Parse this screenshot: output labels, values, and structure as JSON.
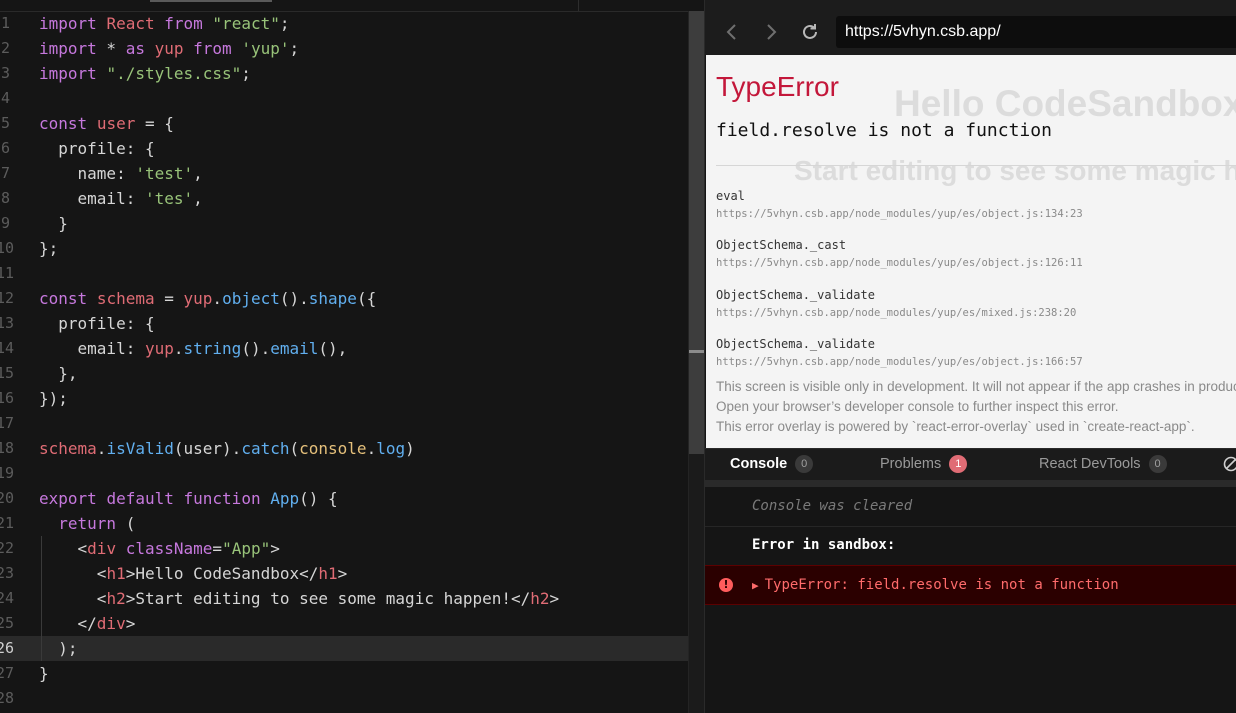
{
  "editor": {
    "lines": [
      {
        "n": "1",
        "tokens": [
          [
            "kw",
            "import"
          ],
          [
            "pn",
            " "
          ],
          [
            "rd",
            "React"
          ],
          [
            "pn",
            " "
          ],
          [
            "kw",
            "from"
          ],
          [
            "pn",
            " "
          ],
          [
            "st",
            "\"react\""
          ],
          [
            "pn",
            ";"
          ]
        ]
      },
      {
        "n": "2",
        "tokens": [
          [
            "kw",
            "import"
          ],
          [
            "pn",
            " * "
          ],
          [
            "kw",
            "as"
          ],
          [
            "pn",
            " "
          ],
          [
            "rd",
            "yup"
          ],
          [
            "pn",
            " "
          ],
          [
            "kw",
            "from"
          ],
          [
            "pn",
            " "
          ],
          [
            "st",
            "'yup'"
          ],
          [
            "pn",
            ";"
          ]
        ]
      },
      {
        "n": "3",
        "tokens": [
          [
            "kw",
            "import"
          ],
          [
            "pn",
            " "
          ],
          [
            "st",
            "\"./styles.css\""
          ],
          [
            "pn",
            ";"
          ]
        ]
      },
      {
        "n": "4",
        "tokens": []
      },
      {
        "n": "5",
        "tokens": [
          [
            "kw",
            "const"
          ],
          [
            "pn",
            " "
          ],
          [
            "rd",
            "user"
          ],
          [
            "pn",
            " = {"
          ]
        ]
      },
      {
        "n": "6",
        "tokens": [
          [
            "pn",
            "  profile: {"
          ]
        ]
      },
      {
        "n": "7",
        "tokens": [
          [
            "pn",
            "    name: "
          ],
          [
            "st",
            "'test'"
          ],
          [
            "pn",
            ","
          ]
        ]
      },
      {
        "n": "8",
        "tokens": [
          [
            "pn",
            "    email: "
          ],
          [
            "st",
            "'tes'"
          ],
          [
            "pn",
            ","
          ]
        ]
      },
      {
        "n": "9",
        "tokens": [
          [
            "pn",
            "  }"
          ]
        ]
      },
      {
        "n": "10",
        "tokens": [
          [
            "pn",
            "};"
          ]
        ]
      },
      {
        "n": "11",
        "tokens": []
      },
      {
        "n": "12",
        "tokens": [
          [
            "kw",
            "const"
          ],
          [
            "pn",
            " "
          ],
          [
            "rd",
            "schema"
          ],
          [
            "pn",
            " = "
          ],
          [
            "rd",
            "yup"
          ],
          [
            "pn",
            "."
          ],
          [
            "fn",
            "object"
          ],
          [
            "pn",
            "()."
          ],
          [
            "fn",
            "shape"
          ],
          [
            "pn",
            "({"
          ]
        ]
      },
      {
        "n": "13",
        "tokens": [
          [
            "pn",
            "  profile: {"
          ]
        ]
      },
      {
        "n": "14",
        "tokens": [
          [
            "pn",
            "    email: "
          ],
          [
            "rd",
            "yup"
          ],
          [
            "pn",
            "."
          ],
          [
            "fn",
            "string"
          ],
          [
            "pn",
            "()."
          ],
          [
            "fn",
            "email"
          ],
          [
            "pn",
            "(),"
          ]
        ]
      },
      {
        "n": "15",
        "tokens": [
          [
            "pn",
            "  },"
          ]
        ]
      },
      {
        "n": "16",
        "tokens": [
          [
            "pn",
            "});"
          ]
        ]
      },
      {
        "n": "17",
        "tokens": []
      },
      {
        "n": "18",
        "tokens": [
          [
            "rd",
            "schema"
          ],
          [
            "pn",
            "."
          ],
          [
            "fn",
            "isValid"
          ],
          [
            "pn",
            "(user)."
          ],
          [
            "fn",
            "catch"
          ],
          [
            "pn",
            "("
          ],
          [
            "yl",
            "console"
          ],
          [
            "pn",
            "."
          ],
          [
            "fn",
            "log"
          ],
          [
            "pn",
            ")"
          ]
        ]
      },
      {
        "n": "19",
        "tokens": []
      },
      {
        "n": "20",
        "tokens": [
          [
            "kw",
            "export"
          ],
          [
            "pn",
            " "
          ],
          [
            "kw",
            "default"
          ],
          [
            "pn",
            " "
          ],
          [
            "kw",
            "function"
          ],
          [
            "pn",
            " "
          ],
          [
            "fn",
            "App"
          ],
          [
            "pn",
            "() {"
          ]
        ]
      },
      {
        "n": "21",
        "tokens": [
          [
            "pn",
            "  "
          ],
          [
            "kw",
            "return"
          ],
          [
            "pn",
            " ("
          ]
        ]
      },
      {
        "n": "22",
        "tokens": [
          [
            "pn",
            "    <"
          ],
          [
            "rd",
            "div"
          ],
          [
            "pn",
            " "
          ],
          [
            "kw",
            "className"
          ],
          [
            "pn",
            "="
          ],
          [
            "st",
            "\"App\""
          ],
          [
            "pn",
            ">"
          ]
        ]
      },
      {
        "n": "23",
        "tokens": [
          [
            "pn",
            "      <"
          ],
          [
            "rd",
            "h1"
          ],
          [
            "pn",
            ">Hello CodeSandbox</"
          ],
          [
            "rd",
            "h1"
          ],
          [
            "pn",
            ">"
          ]
        ]
      },
      {
        "n": "24",
        "tokens": [
          [
            "pn",
            "      <"
          ],
          [
            "rd",
            "h2"
          ],
          [
            "pn",
            ">Start editing to see some magic happen!</"
          ],
          [
            "rd",
            "h2"
          ],
          [
            "pn",
            ">"
          ]
        ]
      },
      {
        "n": "25",
        "tokens": [
          [
            "pn",
            "    </"
          ],
          [
            "rd",
            "div"
          ],
          [
            "pn",
            ">"
          ]
        ]
      },
      {
        "n": "26",
        "tokens": [
          [
            "pn",
            "  );"
          ]
        ]
      },
      {
        "n": "27",
        "tokens": [
          [
            "pn",
            "}"
          ]
        ]
      },
      {
        "n": "28",
        "tokens": []
      }
    ],
    "current_line_index": 25
  },
  "browser": {
    "url": "https://5vhyn.csb.app/",
    "back_icon": "chevron-left-icon",
    "forward_icon": "chevron-right-icon",
    "refresh_icon": "refresh-icon"
  },
  "overlay": {
    "bg_heading": "Hello CodeSandbox",
    "bg_subheading": "Start editing to see some magic happen!",
    "error_title": "TypeError",
    "error_message": "field.resolve is not a function",
    "frames": [
      {
        "name": "eval",
        "location": "https://5vhyn.csb.app/node_modules/yup/es/object.js:134:23"
      },
      {
        "name": "ObjectSchema._cast",
        "location": "https://5vhyn.csb.app/node_modules/yup/es/object.js:126:11"
      },
      {
        "name": "ObjectSchema._validate",
        "location": "https://5vhyn.csb.app/node_modules/yup/es/mixed.js:238:20"
      },
      {
        "name": "ObjectSchema._validate",
        "location": "https://5vhyn.csb.app/node_modules/yup/es/object.js:166:57"
      }
    ],
    "footer": [
      "This screen is visible only in development. It will not appear if the app crashes in production.",
      "Open your browser’s developer console to further inspect this error.",
      "This error overlay is powered by `react-error-overlay` used in `create-react-app`."
    ]
  },
  "console": {
    "tabs": [
      {
        "label": "Console",
        "count": "0"
      },
      {
        "label": "Problems",
        "count": "1"
      },
      {
        "label": "React DevTools",
        "count": "0"
      }
    ],
    "cleared_text": "Console was cleared",
    "sandbox_text": "Error in sandbox:",
    "error_text": "TypeError: field.resolve is not a function"
  },
  "colors": {
    "error_red": "#c3173a",
    "console_error_bg": "#2b0000",
    "badge_red": "#e06c75"
  }
}
